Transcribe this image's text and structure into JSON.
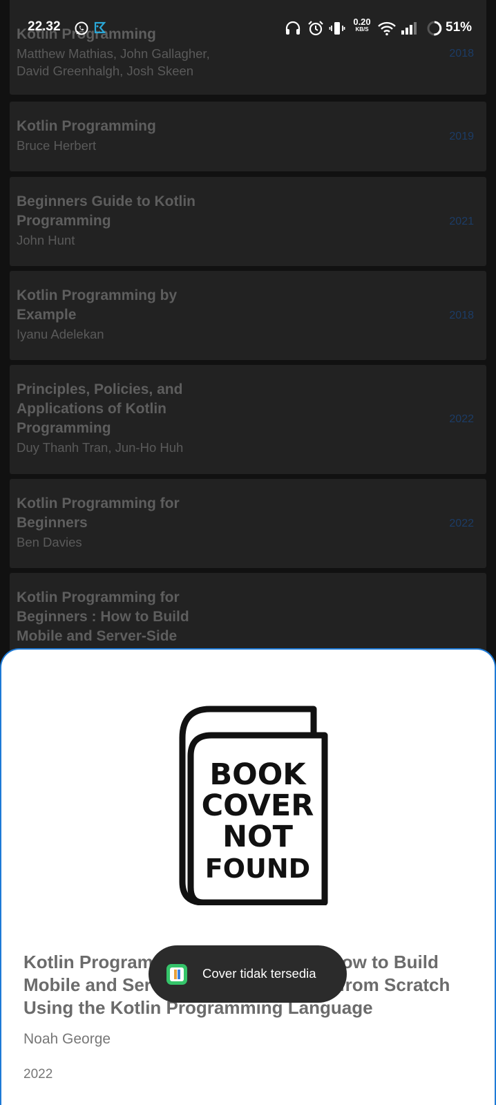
{
  "status_bar": {
    "time": "22.32",
    "net_speed_value": "0.20",
    "net_speed_unit": "KB/S",
    "battery": "51%",
    "icons": [
      "whatsapp-icon",
      "app-notification-icon",
      "headphones-icon",
      "alarm-icon",
      "vibrate-icon",
      "wifi-icon",
      "signal-icon",
      "battery-ring-icon"
    ]
  },
  "books": [
    {
      "title": "Kotlin Programming",
      "author": "Matthew Mathias, John Gallagher, David Greenhalgh, Josh Skeen",
      "year": "2018"
    },
    {
      "title": "Kotlin Programming",
      "author": "Bruce Herbert",
      "year": "2019"
    },
    {
      "title": "Beginners Guide to Kotlin Programming",
      "author": "John Hunt",
      "year": "2021"
    },
    {
      "title": "Kotlin Programming by Example",
      "author": "Iyanu Adelekan",
      "year": "2018"
    },
    {
      "title": "Principles, Policies, and Applications of Kotlin Programming",
      "author": "Duy Thanh Tran, Jun-Ho Huh",
      "year": "2022"
    },
    {
      "title": "Kotlin Programming for Beginners",
      "author": "Ben Davies",
      "year": "2022"
    },
    {
      "title": "Kotlin Programming for Beginners : How to Build Mobile and Server-Side",
      "author": "",
      "year": ""
    }
  ],
  "detail": {
    "cover_text": [
      "BOOK",
      "COVER",
      "NOT",
      "FOUND"
    ],
    "title": "Kotlin Programming for Beginners: How to Build Mobile and Server-Side Applications from Scratch Using the Kotlin Programming Language",
    "author": "Noah George",
    "year": "2022"
  },
  "toast": {
    "message": "Cover tidak tersedia"
  },
  "colors": {
    "sheet_border": "#1e7ad6",
    "year_text": "#1c3c66",
    "card_bg": "#222222",
    "toast_bg": "#2b2b2b"
  }
}
